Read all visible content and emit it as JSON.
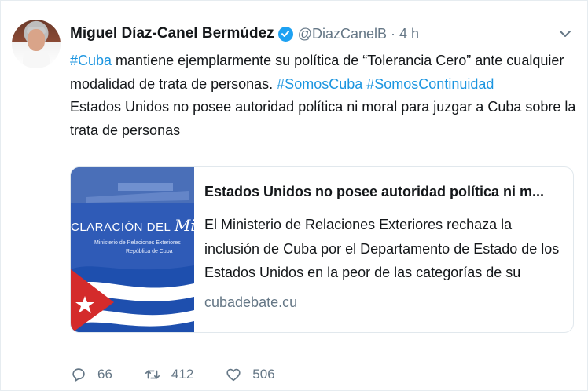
{
  "tweet": {
    "author": {
      "name": "Miguel Díaz-Canel Bermúdez",
      "handle": "@DiazCanelB",
      "separator": "·",
      "time": "4 h"
    },
    "text_lines": [
      [
        {
          "t": "#Cuba",
          "hashtag": true
        },
        {
          "t": " mantiene ejemplarmente su política de “Tolerancia Cero” ante cualquier",
          "hashtag": false
        }
      ],
      [
        {
          "t": "modalidad de trata de personas. ",
          "hashtag": false
        },
        {
          "t": "#SomosCuba",
          "hashtag": true
        },
        {
          "t": " ",
          "hashtag": false
        },
        {
          "t": "#SomosContinuidad",
          "hashtag": true
        }
      ],
      [
        {
          "t": "Estados Unidos no posee autoridad política ni moral para juzgar a Cuba sobre la",
          "hashtag": false
        }
      ],
      [
        {
          "t": "trata de personas",
          "hashtag": false
        }
      ]
    ],
    "card": {
      "image_text": {
        "headline_left": "CLARACIÓN DEL",
        "headline_script": "MinRe",
        "subline_1": "Ministerio de Relaciones Exteriores",
        "subline_2": "República de Cuba"
      },
      "title": "Estados Unidos no posee autoridad política ni m...",
      "description_lines": [
        "El Ministerio de Relaciones Exteriores rechaza la",
        "inclusión de Cuba por el Departamento de Estado de los",
        "Estados Unidos en la peor de las categorías de su"
      ],
      "domain": "cubadebate.cu"
    },
    "actions": {
      "reply_count": "66",
      "retweet_count": "412",
      "like_count": "506"
    }
  },
  "colors": {
    "hashtag": "#1b95e0",
    "muted": "#657786",
    "verified": "#1da1f2",
    "border": "#e1e8ed"
  },
  "icons": [
    "verified-badge-icon",
    "chevron-down-icon",
    "reply-icon",
    "retweet-icon",
    "like-icon"
  ]
}
